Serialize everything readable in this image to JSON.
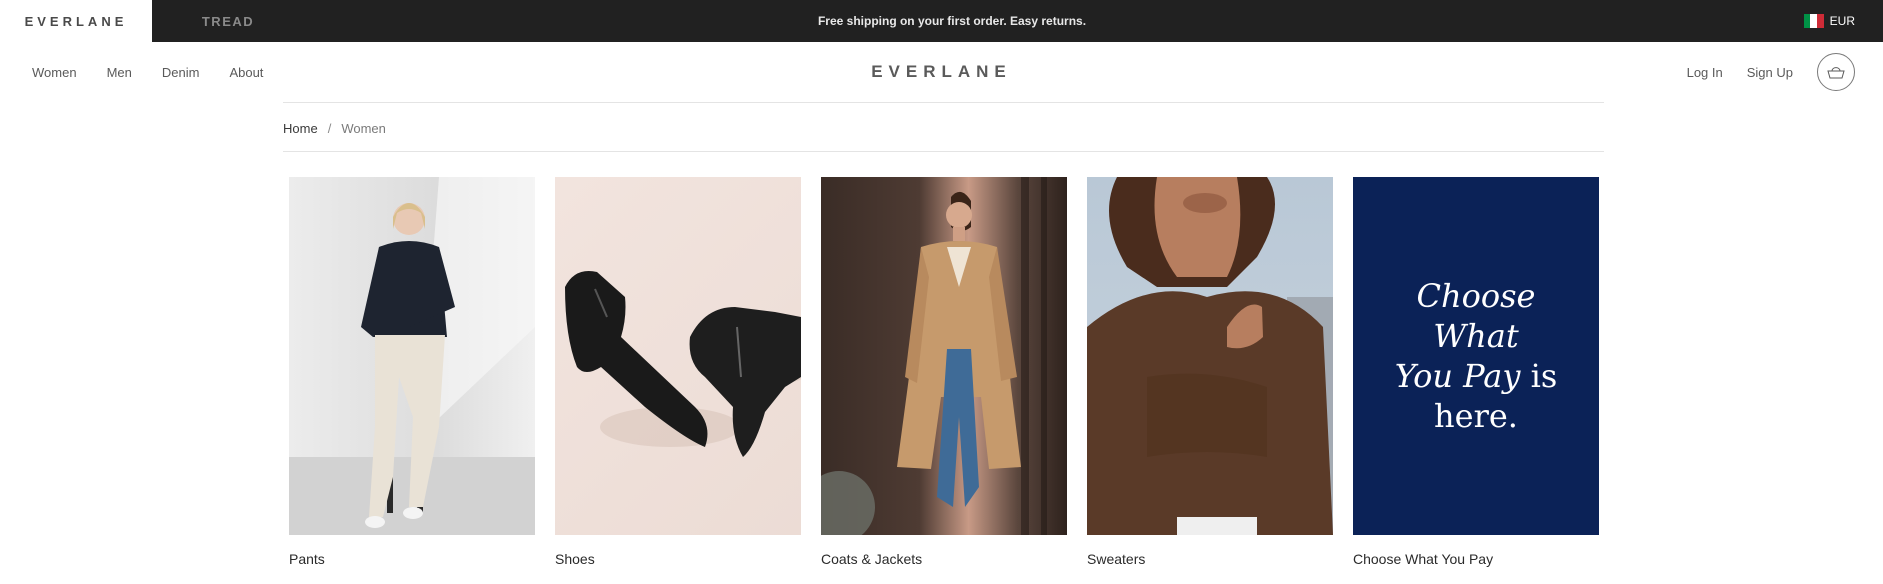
{
  "topbar": {
    "brand": "EVERLANE",
    "tread": "TREAD",
    "promo": "Free shipping on your first order. Easy returns.",
    "currency": "EUR",
    "flag_colors": [
      "#009246",
      "#ffffff",
      "#ce2b37"
    ]
  },
  "header": {
    "nav": [
      "Women",
      "Men",
      "Denim",
      "About"
    ],
    "logo": "EVERLANE",
    "login": "Log In",
    "signup": "Sign Up",
    "cart_icon": "shopping-bag-icon"
  },
  "breadcrumb": {
    "home": "Home",
    "separator": "/",
    "current": "Women"
  },
  "categories": [
    {
      "label": "Pants"
    },
    {
      "label": "Shoes"
    },
    {
      "label": "Coats & Jackets"
    },
    {
      "label": "Sweaters"
    },
    {
      "label": "Choose What You Pay"
    }
  ],
  "promo_tile": {
    "line1": "Choose What",
    "line2_italic": "You Pay",
    "line2_rest": " is",
    "line3": "here."
  },
  "colors": {
    "topbar_bg": "#212121",
    "promo_tile_bg": "#0b2257"
  }
}
